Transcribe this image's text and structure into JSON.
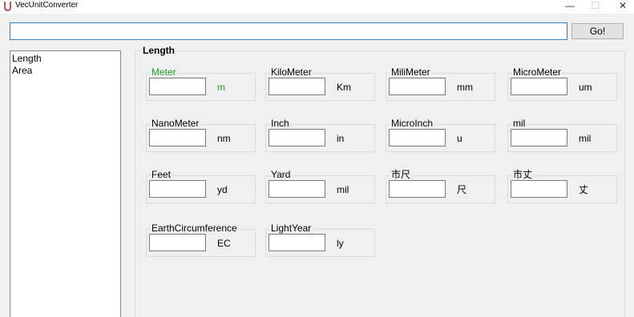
{
  "window": {
    "title": "VecUnitConverter",
    "minimize_glyph": "—",
    "maximize_glyph": "☐",
    "close_glyph": "✕"
  },
  "search": {
    "value": "",
    "placeholder": ""
  },
  "go_label": "Go!",
  "categories": [
    "Length",
    "Area"
  ],
  "group_title": "Length",
  "units": [
    {
      "label": "Meter",
      "suffix": "m",
      "value": "",
      "active": true
    },
    {
      "label": "KiloMeter",
      "suffix": "Km",
      "value": ""
    },
    {
      "label": "MiliMeter",
      "suffix": "mm",
      "value": ""
    },
    {
      "label": "MicroMeter",
      "suffix": "um",
      "value": ""
    },
    {
      "label": "NanoMeter",
      "suffix": "nm",
      "value": ""
    },
    {
      "label": "Inch",
      "suffix": "in",
      "value": ""
    },
    {
      "label": "MicroInch",
      "suffix": "u",
      "value": ""
    },
    {
      "label": "mil",
      "suffix": "mil",
      "value": ""
    },
    {
      "label": "Feet",
      "suffix": "yd",
      "value": ""
    },
    {
      "label": "Yard",
      "suffix": "mil",
      "value": ""
    },
    {
      "label": "市尺",
      "suffix": "尺",
      "value": ""
    },
    {
      "label": "市丈",
      "suffix": "丈",
      "value": ""
    },
    {
      "label": "EarthCircumference",
      "suffix": "EC",
      "value": ""
    },
    {
      "label": "LightYear",
      "suffix": "ly",
      "value": ""
    }
  ],
  "colors": {
    "active_unit": "#1e9e1e",
    "app_icon": "#c62828",
    "input_focus_border": "#3c7fb1"
  }
}
